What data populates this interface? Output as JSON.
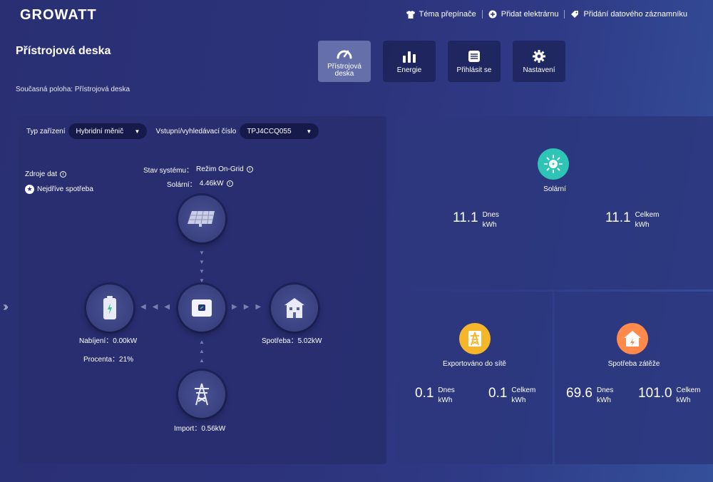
{
  "header": {
    "logo": "GROWATT",
    "links": [
      {
        "label": "Téma přepínače",
        "icon": "shirt-icon"
      },
      {
        "label": "Přidat elektrárnu",
        "icon": "plus-circle-icon"
      },
      {
        "label": "Přidání datového záznamníku",
        "icon": "tag-icon"
      }
    ]
  },
  "page": {
    "title": "Přístrojová deska",
    "breadcrumb": "Současná poloha: Přístrojová deska"
  },
  "tabs": [
    {
      "label": "Přístrojová deska",
      "icon": "gauge-icon",
      "active": true
    },
    {
      "label": "Energie",
      "icon": "bar-chart-icon",
      "active": false
    },
    {
      "label": "Přihlásit se",
      "icon": "log-icon",
      "active": false
    },
    {
      "label": "Nastavení",
      "icon": "gear-icon",
      "active": false
    }
  ],
  "filters": {
    "device_type_label": "Typ zařízení",
    "device_type_value": "Hybridní měnič",
    "serial_label": "Vstupní/vyhledávací číslo",
    "serial_value": "TPJ4CCQ055"
  },
  "data_source": {
    "title": "Zdroje dat",
    "option": "Nejdříve spotřeba"
  },
  "system": {
    "status_label": "Stav systému：",
    "status_value": "Režim On-Grid",
    "solar_label": "Solární：",
    "solar_value": "4.46kW",
    "charging_label": "Nabíjení：",
    "charging_value": "0.00kW",
    "percent_label": "Procenta：",
    "percent_value": "21%",
    "consumption_label": "Spotřeba：",
    "consumption_value": "5.02kW",
    "import_label": "Import：",
    "import_value": "0.56kW"
  },
  "solar_card": {
    "title": "Solární",
    "today_value": "11.1",
    "today_label": "Dnes",
    "total_value": "11.1",
    "total_label": "Celkem",
    "unit": "kWh",
    "color": "#2ec4b6"
  },
  "export_card": {
    "title": "Exportováno do sítě",
    "today_value": "0.1",
    "today_label": "Dnes",
    "total_value": "0.1",
    "total_label": "Celkem",
    "unit": "kWh",
    "color": "#f5b62a"
  },
  "load_card": {
    "title": "Spotřeba zátěže",
    "today_value": "69.6",
    "today_label": "Dnes",
    "total_value": "101.0",
    "total_label": "Celkem",
    "unit": "kWh",
    "color": "#ff8a4c"
  }
}
